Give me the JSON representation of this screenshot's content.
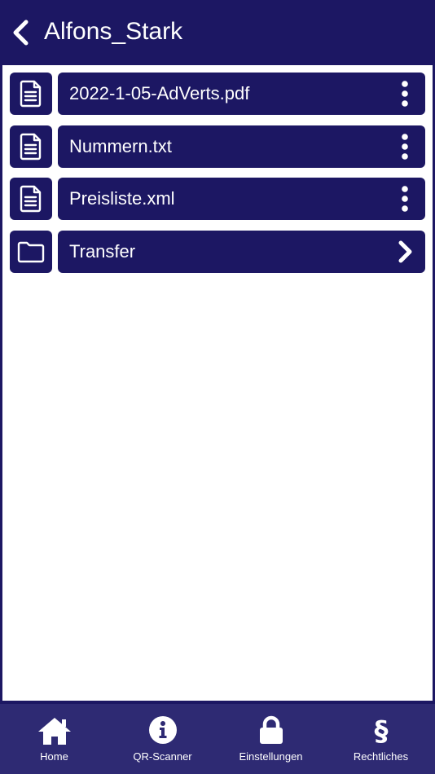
{
  "header": {
    "title": "Alfons_Stark",
    "back_icon": "chevron-left-icon"
  },
  "files": [
    {
      "name": "2022-1-05-AdVerts.pdf",
      "type": "file",
      "icon": "document-icon",
      "action_icon": "more-vertical-icon"
    },
    {
      "name": "Nummern.txt",
      "type": "file",
      "icon": "document-icon",
      "action_icon": "more-vertical-icon"
    },
    {
      "name": "Preisliste.xml",
      "type": "file",
      "icon": "document-icon",
      "action_icon": "more-vertical-icon"
    },
    {
      "name": "Transfer",
      "type": "folder",
      "icon": "folder-icon",
      "action_icon": "chevron-right-icon"
    }
  ],
  "tabs": [
    {
      "label": "Home",
      "icon": "home-icon"
    },
    {
      "label": "QR-Scanner",
      "icon": "info-icon"
    },
    {
      "label": "Einstellungen",
      "icon": "lock-icon"
    },
    {
      "label": "Rechtliches",
      "icon": "section-icon"
    }
  ],
  "colors": {
    "primary": "#1c1763",
    "tabbar": "#2e2a73",
    "background": "#ffffff",
    "text": "#ffffff"
  }
}
